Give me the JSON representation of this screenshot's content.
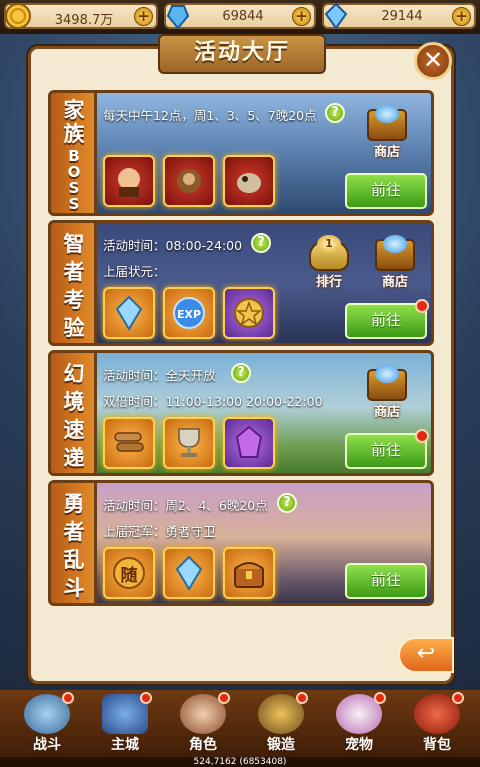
{
  "currency": [
    {
      "icon": "gold-coin-icon",
      "value": "3498.7万"
    },
    {
      "icon": "blue-crystal-icon",
      "value": "69844"
    },
    {
      "icon": "diamond-icon",
      "value": "29144"
    }
  ],
  "title": "活动大厅",
  "close_label": "✕",
  "go_label": "前往",
  "activities": [
    {
      "side_chars": [
        "家",
        "族",
        "B",
        "O",
        "S",
        "S"
      ],
      "lines": [
        "每天中午12点，周1、3、5、7晚20点"
      ],
      "items": [
        "boss-portrait-icon",
        "boss-portrait-icon",
        "boss-portrait-icon"
      ],
      "shop_label": "商店"
    },
    {
      "side_chars": [
        "智",
        "者",
        "考",
        "验"
      ],
      "lines": [
        "活动时间：08:00-24:00",
        "上届状元："
      ],
      "items": [
        "crystal-icon",
        "exp-orb-icon",
        "star-seal-icon"
      ],
      "rank_label": "排行",
      "rank_number": "1",
      "shop_label": "商店"
    },
    {
      "side_chars": [
        "幻",
        "境",
        "速",
        "递"
      ],
      "lines": [
        "活动时间：全天开放",
        "双倍时间：11:00-13:00  20:00-22:00"
      ],
      "items": [
        "wood-logs-icon",
        "trophy-cup-icon",
        "purple-gem-icon"
      ],
      "shop_label": "商店"
    },
    {
      "side_chars": [
        "勇",
        "者",
        "乱",
        "斗"
      ],
      "lines": [
        "活动时间：周2、4、6晚20点",
        "上届冠军：勇者守卫"
      ],
      "items": [
        "random-token-icon",
        "crystal-icon",
        "treasure-chest-icon"
      ],
      "random_char": "随"
    }
  ],
  "back_label": "↩",
  "nav": [
    "战斗",
    "主城",
    "角色",
    "锻造",
    "宠物",
    "背包"
  ],
  "coords": "524,7162   (6853408)"
}
